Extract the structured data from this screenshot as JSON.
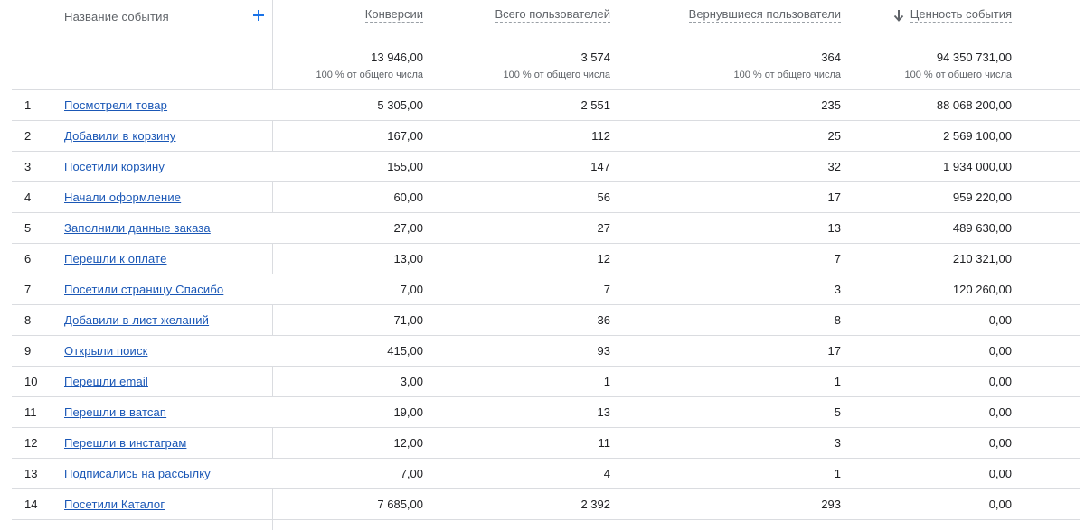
{
  "header": {
    "event_name": "Название события",
    "columns": [
      {
        "label": "Конверсии",
        "total": "13 946,00",
        "total_sub": "100 % от общего числа"
      },
      {
        "label": "Всего пользователей",
        "total": "3 574",
        "total_sub": "100 % от общего числа"
      },
      {
        "label": "Вернувшиеся пользователи",
        "total": "364",
        "total_sub": "100 % от общего числа"
      },
      {
        "label": "Ценность события",
        "total": "94 350 731,00",
        "total_sub": "100 % от общего числа",
        "sorted": "desc"
      }
    ]
  },
  "colors": {
    "link": "#1a57b6",
    "accent": "#1a73e8",
    "divider": "#dadce0"
  },
  "rows": [
    {
      "idx": "1",
      "name": "Посмотрели товар",
      "conv": "5 305,00",
      "users": "2 551",
      "returning": "235",
      "value": "88 068 200,00"
    },
    {
      "idx": "2",
      "name": "Добавили в корзину",
      "conv": "167,00",
      "users": "112",
      "returning": "25",
      "value": "2 569 100,00"
    },
    {
      "idx": "3",
      "name": "Посетили корзину",
      "conv": "155,00",
      "users": "147",
      "returning": "32",
      "value": "1 934 000,00"
    },
    {
      "idx": "4",
      "name": "Начали оформление",
      "conv": "60,00",
      "users": "56",
      "returning": "17",
      "value": "959 220,00"
    },
    {
      "idx": "5",
      "name": "Заполнили данные заказа",
      "conv": "27,00",
      "users": "27",
      "returning": "13",
      "value": "489 630,00"
    },
    {
      "idx": "6",
      "name": "Перешли к оплате",
      "conv": "13,00",
      "users": "12",
      "returning": "7",
      "value": "210 321,00"
    },
    {
      "idx": "7",
      "name": "Посетили страницу Спасибо",
      "conv": "7,00",
      "users": "7",
      "returning": "3",
      "value": "120 260,00"
    },
    {
      "idx": "8",
      "name": "Добавили в лист желаний",
      "conv": "71,00",
      "users": "36",
      "returning": "8",
      "value": "0,00"
    },
    {
      "idx": "9",
      "name": "Открыли поиск",
      "conv": "415,00",
      "users": "93",
      "returning": "17",
      "value": "0,00"
    },
    {
      "idx": "10",
      "name": "Перешли email",
      "conv": "3,00",
      "users": "1",
      "returning": "1",
      "value": "0,00"
    },
    {
      "idx": "11",
      "name": "Перешли в ватсап",
      "conv": "19,00",
      "users": "13",
      "returning": "5",
      "value": "0,00"
    },
    {
      "idx": "12",
      "name": "Перешли в инстаграм",
      "conv": "12,00",
      "users": "11",
      "returning": "3",
      "value": "0,00"
    },
    {
      "idx": "13",
      "name": "Подписались на рассылку",
      "conv": "7,00",
      "users": "4",
      "returning": "1",
      "value": "0,00"
    },
    {
      "idx": "14",
      "name": "Посетили Каталог",
      "conv": "7 685,00",
      "users": "2 392",
      "returning": "293",
      "value": "0,00"
    }
  ]
}
